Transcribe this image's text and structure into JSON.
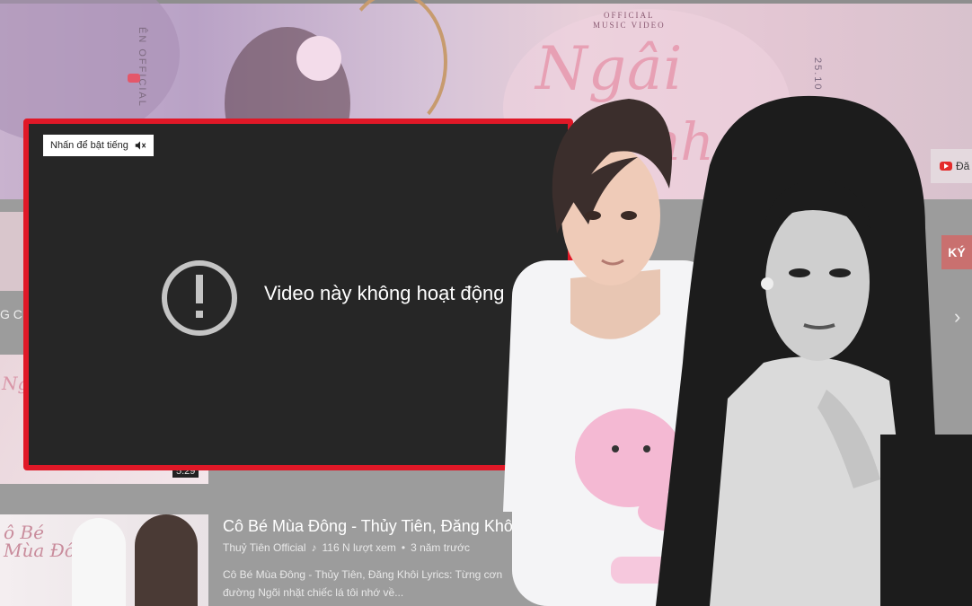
{
  "banner": {
    "vertical_text_left": "ÊN OFFICIAL",
    "vertical_text_right": "25.10",
    "official_label_1": "OFFICIAL",
    "official_label_2": "MUSIC VIDEO",
    "song_title_part1": "Ngâi",
    "song_title_part2": "nh",
    "channel_button_label": "Đă"
  },
  "channel": {
    "subscribe_label": "KÝ",
    "carousel_next": "›",
    "left_label": "G CH"
  },
  "player": {
    "unmute_label": "Nhấn để bật tiếng",
    "error_message": "Video này không hoạt động"
  },
  "thumbnail_2": {
    "title_text": "Ngô H",
    "duration": "5:29"
  },
  "video_item": {
    "thumb_text_line1": "ô Bé",
    "thumb_text_line2": "Mùa Đông",
    "title": "Cô Bé Mùa Đông - Thủy Tiên, Đăng Khôi",
    "channel": "Thuỷ Tiên Official",
    "views": "116 N lượt xem",
    "separator": "•",
    "age": "3 năm trước",
    "description_line1": "Cô Bé Mùa Đông - Thủy Tiên, Đăng Khôi Lyrics: Từng cơn",
    "description_line2": "đường Ngõi nhặt chiếc lá tôi nhớ về..."
  },
  "colors": {
    "frame_red": "#e01827",
    "player_bg": "#262626",
    "page_grey": "#9c9c9c"
  }
}
